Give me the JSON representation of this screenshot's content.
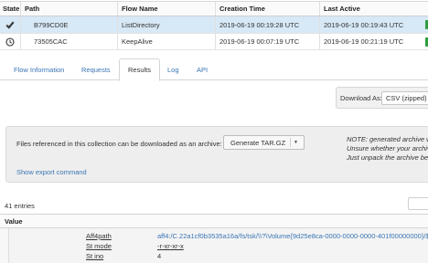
{
  "flows_table": {
    "headers": [
      "State",
      "Path",
      "Flow Name",
      "Creation Time",
      "Last Active"
    ],
    "rows": [
      {
        "state_icon": "checkmark-icon",
        "path": "B799CD0E",
        "flow_name": "ListDirectory",
        "creation_time": "2019-06-19 00:19:28 UTC",
        "last_active": "2019-06-19 00:19:43 UTC"
      },
      {
        "state_icon": "clock-icon",
        "path": "73505CAC",
        "flow_name": "KeepAlive",
        "creation_time": "2019-06-19 00:07:19 UTC",
        "last_active": "2019-06-19 00:21:19 UTC"
      }
    ]
  },
  "tabs": [
    {
      "label": "Flow Information",
      "active": false
    },
    {
      "label": "Requests",
      "active": false
    },
    {
      "label": "Results",
      "active": true
    },
    {
      "label": "Log",
      "active": false
    },
    {
      "label": "API",
      "active": false
    }
  ],
  "download": {
    "label": "Download As:",
    "selected": "CSV (zipped)"
  },
  "archive": {
    "text": "Files referenced in this collection can be downloaded as an archive:",
    "button_label": "Generate TAR.GZ",
    "note_lines": [
      "NOTE: generated archive w",
      "Unsure whether your archiv",
      "Just unpack the archive be"
    ],
    "export_link": "Show export command"
  },
  "entries": {
    "label": "41 entries"
  },
  "value_table": {
    "header": "Value",
    "items": [
      {
        "key": "Aff4path",
        "value": "aff4:/C.22a1cf0b3535a16a/fs/tsk/\\\\?\\Volume{9d25e8ca-0000-0000-0000-401f00000000}/$At"
      },
      {
        "key": "St mode",
        "value": "-r-xr-xr-x"
      },
      {
        "key": "St ino",
        "value": "4"
      }
    ]
  },
  "colors": {
    "selected_row": "#d7e8f6",
    "link": "#3a76b4",
    "status_green": "#2e9e3f"
  }
}
